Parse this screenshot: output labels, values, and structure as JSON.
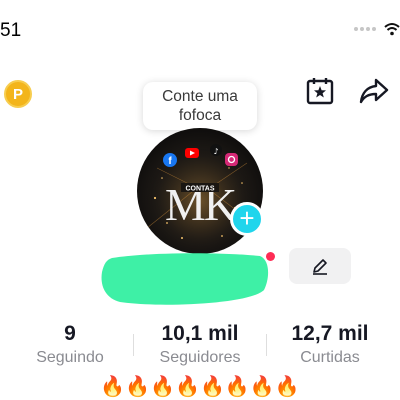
{
  "status_bar": {
    "time": "51"
  },
  "header": {
    "coin_letter": "P",
    "favorites_icon": "calendar-star-icon",
    "share_icon": "share-arrow-icon"
  },
  "note_bubble": {
    "text": "Conte uma fofoca"
  },
  "avatar": {
    "logo_letters": "MK",
    "logo_caption": "CONTAS",
    "social_icons": [
      "facebook-icon",
      "youtube-icon",
      "tiktok-icon",
      "instagram-icon"
    ]
  },
  "profile": {
    "name_redacted": true,
    "edit_icon": "pencil-icon"
  },
  "stats": [
    {
      "value": "9",
      "label": "Seguindo"
    },
    {
      "value": "10,1 mil",
      "label": "Seguidores"
    },
    {
      "value": "12,7 mil",
      "label": "Curtidas"
    }
  ],
  "bio": {
    "text": "🔥🔥🔥🔥🔥🔥🔥🔥"
  },
  "colors": {
    "accent_cyan": "#20d5ec",
    "notification_red": "#fe2c55",
    "redaction_green": "#3ef0a6",
    "coin_gold": "#f3b51b"
  }
}
